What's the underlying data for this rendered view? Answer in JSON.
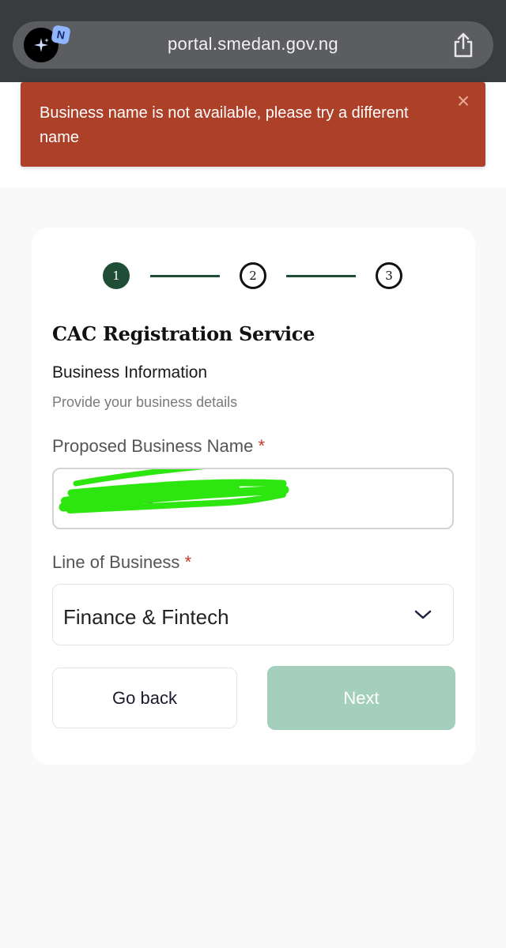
{
  "browser": {
    "url": "portal.smedan.gov.ng",
    "extension_badge": "N",
    "icons": {
      "extension": "sparkle-icon",
      "share": "share-icon"
    }
  },
  "toast": {
    "message": "Business name is not available, please try a different name",
    "close": "×",
    "color": "#ad4029"
  },
  "stepper": {
    "steps": [
      "1",
      "2",
      "3"
    ],
    "current": 1,
    "accent": "#1f4d35"
  },
  "form": {
    "title": "CAC Registration Service",
    "section": "Business Information",
    "helper": "Provide your business details",
    "business_name": {
      "label": "Proposed Business Name",
      "required_mark": "*",
      "value": "A          Ventures",
      "redacted": true
    },
    "line_of_business": {
      "label": "Line of Business",
      "required_mark": "*",
      "value": "Finance & Fintech"
    },
    "buttons": {
      "back": "Go back",
      "next": "Next",
      "next_color": "#a5cfbd"
    }
  }
}
